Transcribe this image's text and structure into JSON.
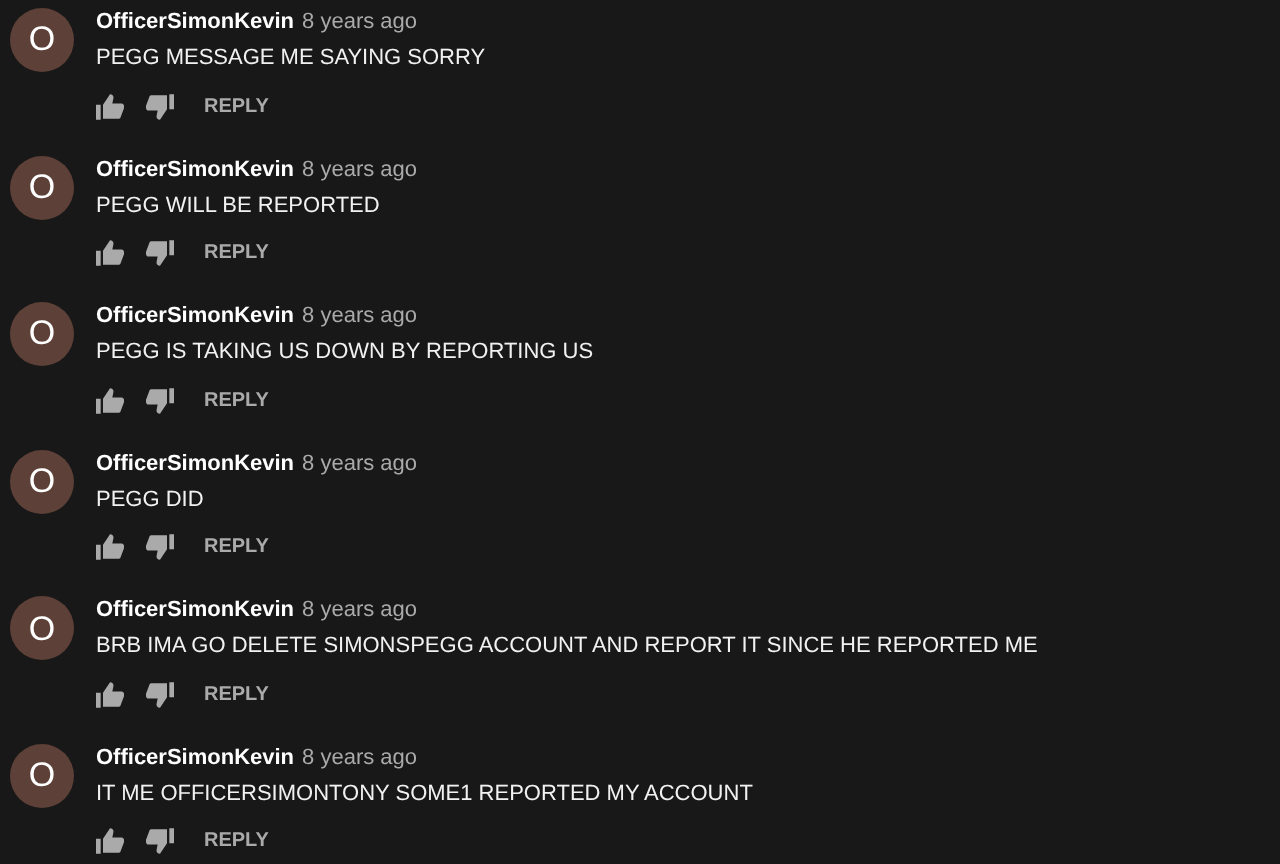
{
  "comments": [
    {
      "avatar": "O",
      "author": "OfficerSimonKevin",
      "time": "8 years ago",
      "text": "PEGG MESSAGE ME SAYING SORRY",
      "reply": "REPLY"
    },
    {
      "avatar": "O",
      "author": "OfficerSimonKevin",
      "time": "8 years ago",
      "text": "PEGG WILL BE REPORTED",
      "reply": "REPLY"
    },
    {
      "avatar": "O",
      "author": "OfficerSimonKevin",
      "time": "8 years ago",
      "text": "PEGG IS TAKING US DOWN BY REPORTING US",
      "reply": "REPLY"
    },
    {
      "avatar": "O",
      "author": "OfficerSimonKevin",
      "time": "8 years ago",
      "text": "PEGG DID",
      "reply": "REPLY"
    },
    {
      "avatar": "O",
      "author": "OfficerSimonKevin",
      "time": "8 years ago",
      "text": "BRB IMA GO DELETE SIMONSPEGG ACCOUNT AND REPORT IT SINCE HE REPORTED ME",
      "reply": "REPLY"
    },
    {
      "avatar": "O",
      "author": "OfficerSimonKevin",
      "time": "8 years ago",
      "text": "IT ME OFFICERSIMONTONY SOME1 REPORTED MY ACCOUNT",
      "reply": "REPLY"
    }
  ]
}
